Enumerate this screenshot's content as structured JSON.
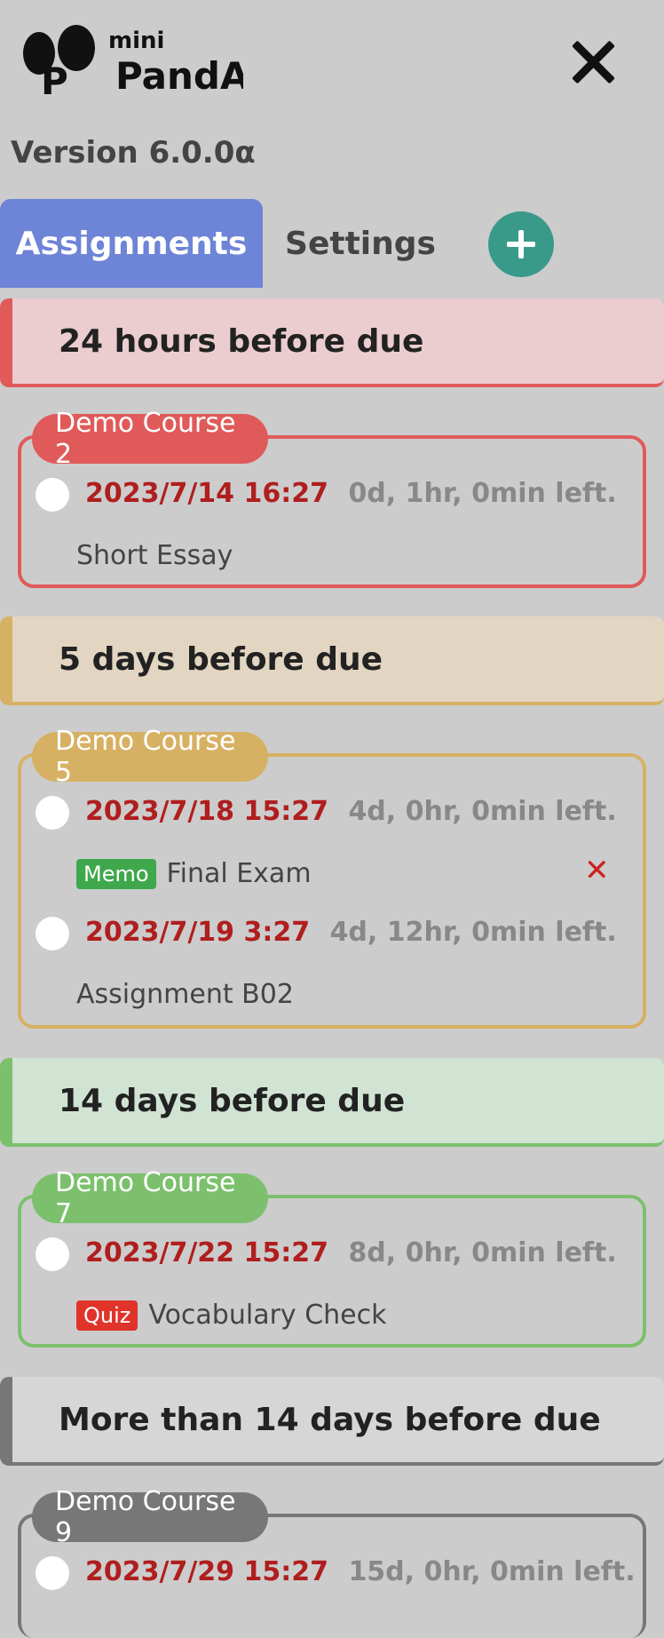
{
  "app": {
    "logo_small": "mini",
    "logo_large": "PandA",
    "version": "Version 6.0.0α"
  },
  "tabs": [
    {
      "label": "Assignments"
    },
    {
      "label": "Settings"
    }
  ],
  "colors": {
    "red": "#e05a5a",
    "yellow": "#d7b163",
    "green": "#7cc06e",
    "gray": "#777777",
    "due": "#b01e1e"
  },
  "sections": [
    {
      "header": "24 hours before due",
      "courses": [
        {
          "name": "Demo Course 2",
          "items": [
            {
              "due": "2023/7/14 16:27",
              "left": "0d, 1hr, 0min left.",
              "title": "Short Essay"
            }
          ]
        }
      ]
    },
    {
      "header": "5 days before due",
      "courses": [
        {
          "name": "Demo Course 5",
          "items": [
            {
              "due": "2023/7/18 15:27",
              "left": "4d, 0hr, 0min left.",
              "tag": "Memo",
              "title": "Final Exam"
            },
            {
              "due": "2023/7/19 3:27",
              "left": "4d, 12hr, 0min left.",
              "title": "Assignment B02"
            }
          ]
        }
      ]
    },
    {
      "header": "14 days before due",
      "courses": [
        {
          "name": "Demo Course 7",
          "items": [
            {
              "due": "2023/7/22 15:27",
              "left": "8d, 0hr, 0min left.",
              "tag": "Quiz",
              "title": "Vocabulary Check"
            }
          ]
        }
      ]
    },
    {
      "header": "More than 14 days before due",
      "courses": [
        {
          "name": "Demo Course 9",
          "items": [
            {
              "due": "2023/7/29 15:27",
              "left": "15d, 0hr, 0min left."
            }
          ]
        }
      ]
    }
  ]
}
